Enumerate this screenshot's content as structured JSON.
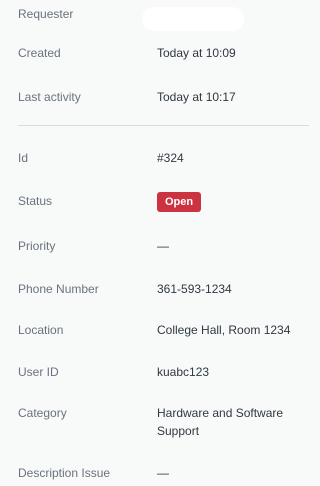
{
  "ticket_properties": {
    "requester": {
      "label": "Requester",
      "value": ""
    },
    "created": {
      "label": "Created",
      "value": "Today at 10:09"
    },
    "last_activity": {
      "label": "Last activity",
      "value": "Today at 10:17"
    },
    "id": {
      "label": "Id",
      "value": "#324"
    },
    "status": {
      "label": "Status",
      "value": "Open",
      "badge_color": "#cc3340"
    },
    "priority": {
      "label": "Priority",
      "value": "—"
    },
    "phone_number": {
      "label": "Phone Number",
      "value": "361-593-1234"
    },
    "location": {
      "label": "Location",
      "value": "College Hall, Room 1234"
    },
    "user_id": {
      "label": "User ID",
      "value": "kuabc123"
    },
    "category": {
      "label": "Category",
      "value": "Hardware and Software Support"
    },
    "description_issue": {
      "label": "Description Issue",
      "value": "—"
    }
  }
}
